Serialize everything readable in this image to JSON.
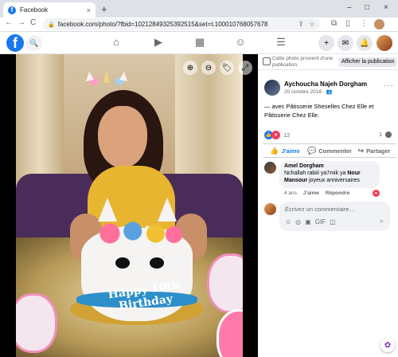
{
  "browser": {
    "tab_title": "Facebook",
    "tab_favicon": "f",
    "close_tab": "×",
    "new_tab": "+",
    "window_controls": [
      "–",
      "□",
      "×"
    ],
    "nav": {
      "back": "←",
      "forward": "→",
      "reload": "C"
    },
    "url": "facebook.com/photo/?fbid=10212849325392515&set=t.100010768057678",
    "lock_icon": "🔒",
    "share_icon": "⇪",
    "star_icon": "☆",
    "toolbar_icons": [
      "⧉",
      "▯",
      "⋮"
    ]
  },
  "fb": {
    "logo": "f",
    "search_icon": "🔍",
    "nav_icons": [
      "⌂",
      "▶",
      "▦",
      "☺",
      "☰"
    ],
    "right_buttons": [
      "+",
      "✉",
      "🔔"
    ]
  },
  "viewer": {
    "zoom_in": "⊕",
    "zoom_out": "⊖",
    "tag": "🏷",
    "fullscreen": "⤢",
    "cake_text": "Happy 10th Birthday"
  },
  "panel": {
    "notice_text": "Cette photo provient d'une publication.",
    "notice_button": "Afficher la publication",
    "author_name": "Aychoucha Najeh Dorgham",
    "post_date": "20 octobre 2018 · ",
    "audience_icon": "👥",
    "more": "···",
    "caption": "— avec Pâtisserie Sheselles Chez Elle et Pâtisserie Chez Elle.",
    "reactions_count": "12",
    "comments_count": "1",
    "actions": [
      {
        "icon": "👍",
        "label": "J'aime"
      },
      {
        "icon": "💬",
        "label": "Commenter"
      },
      {
        "icon": "↪",
        "label": "Partager"
      }
    ],
    "comment": {
      "author": "Amel Dorgham",
      "text_before": "Nchallah rabiii ya7mik ya ",
      "mention": "Nour Mansour",
      "text_after": " joyeux anniversaires",
      "age": "4 ans",
      "like": "J'aime",
      "reply": "Répondre",
      "reaction": "♥"
    },
    "input_placeholder": "Écrivez un commentaire…",
    "input_icons": [
      "☺",
      "◎",
      "▣",
      "GIF",
      "◫"
    ],
    "send_icon": "➤"
  },
  "fab_icon": "✿",
  "colors": {
    "fb_blue": "#1877f2",
    "love_red": "#f33e58",
    "panel_bg": "#ffffff"
  }
}
